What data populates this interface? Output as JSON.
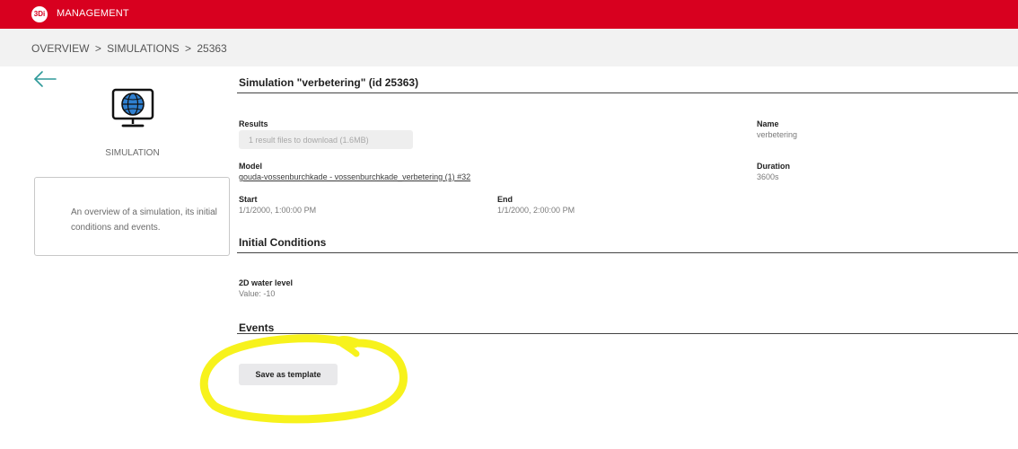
{
  "header": {
    "logo_text": "3Di",
    "title": "MANAGEMENT"
  },
  "breadcrumb": {
    "items": [
      "OVERVIEW",
      "SIMULATIONS",
      "25363"
    ],
    "separator": ">"
  },
  "sidebar": {
    "back_icon": "arrow-left-icon",
    "type_icon": "globe-monitor-icon",
    "type_label": "SIMULATION",
    "description": "An overview of a simulation, its initial conditions and events."
  },
  "simulation": {
    "title": "Simulation \"verbetering\" (id 25363)",
    "results_label": "Results",
    "results_button": "1 result files to download (1.6MB)",
    "name_label": "Name",
    "name_value": "verbetering",
    "model_label": "Model",
    "model_value": "gouda-vossenburchkade - vossenburchkade_verbetering (1) #32",
    "duration_label": "Duration",
    "duration_value": "3600s",
    "start_label": "Start",
    "start_value": "1/1/2000, 1:00:00 PM",
    "end_label": "End",
    "end_value": "1/1/2000, 2:00:00 PM"
  },
  "initial_conditions": {
    "title": "Initial Conditions",
    "items": [
      {
        "label": "2D water level",
        "value": "Value: -10"
      }
    ]
  },
  "events": {
    "title": "Events"
  },
  "actions": {
    "save_template_label": "Save as template"
  },
  "colors": {
    "brand_red": "#d8001f",
    "accent_teal": "#2f9a9a",
    "highlight_yellow": "#f7f21c"
  }
}
